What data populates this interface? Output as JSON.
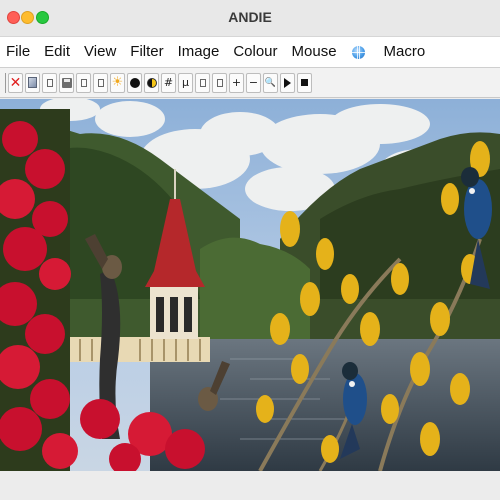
{
  "window": {
    "title": "ANDIE"
  },
  "menubar": {
    "items": [
      "File",
      "Edit",
      "View",
      "Filter",
      "Image",
      "Colour",
      "Mouse"
    ],
    "language_icon": "globe-icon",
    "macro": "Macro"
  },
  "toolbar": {
    "buttons": [
      {
        "icon": "close-icon",
        "text": "✕"
      },
      {
        "icon": "open-file-icon"
      },
      {
        "icon": "blank-icon"
      },
      {
        "icon": "save-icon"
      },
      {
        "icon": "blank-icon"
      },
      {
        "icon": "blank-icon"
      },
      {
        "icon": "brightness-icon",
        "text": "☀"
      },
      {
        "icon": "filled-circle-icon"
      },
      {
        "icon": "half-circle-icon"
      },
      {
        "icon": "sharpen-icon",
        "text": "#"
      },
      {
        "icon": "mu-icon",
        "text": "μ"
      },
      {
        "icon": "blank-icon"
      },
      {
        "icon": "blank-icon"
      },
      {
        "icon": "plus-icon",
        "text": "+"
      },
      {
        "icon": "minus-icon",
        "text": "−"
      },
      {
        "icon": "magnifier-icon",
        "text": "🔍"
      },
      {
        "icon": "play-icon"
      },
      {
        "icon": "stop-icon"
      }
    ]
  },
  "colors": {
    "close": "#ff5f57",
    "minimize": "#febc2e",
    "maximize": "#28c840",
    "pohutukawa_red": "#c8102e",
    "kowhai_yellow": "#e5b21a",
    "rotunda_red": "#b5282b"
  }
}
